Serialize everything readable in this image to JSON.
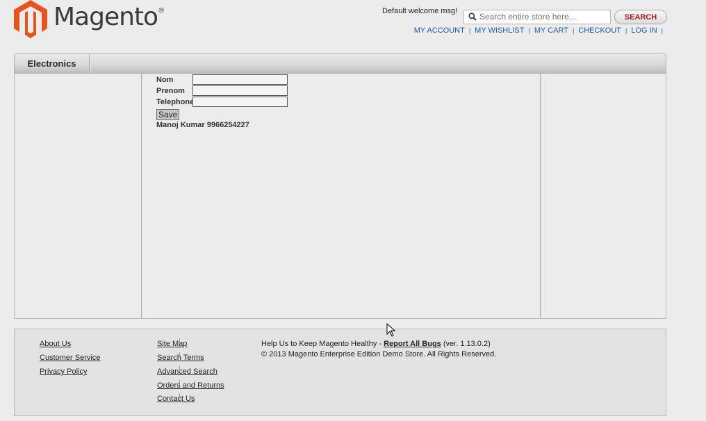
{
  "logo": {
    "text": "Magento",
    "reg": "®"
  },
  "header": {
    "welcome": "Default welcome msg!",
    "search_placeholder": "Search entire store here...",
    "search_button": "SEARCH",
    "links": [
      "MY ACCOUNT",
      "MY WISHLIST",
      "MY CART",
      "CHECKOUT",
      "LOG IN"
    ]
  },
  "nav": {
    "items": [
      "Electronics"
    ]
  },
  "form": {
    "labels": [
      "Nom",
      "Prenom",
      "Telephone"
    ],
    "values": [
      "",
      "",
      ""
    ],
    "save_label": "Save",
    "result": "Manoj Kumar 9966254227"
  },
  "footer": {
    "col1": [
      "About Us",
      "Customer Service",
      "Privacy Policy"
    ],
    "col2": [
      "Site Map",
      "Search Terms",
      "Advanced Search",
      "Orders and Returns",
      "Contact Us"
    ],
    "help_prefix": "Help Us to Keep Magento Healthy - ",
    "help_link": "Report All Bugs",
    "help_suffix": " (ver. 1.13.0.2)",
    "copyright": "© 2013 Magento Enterprise Edition Demo Store. All Rights Reserved."
  },
  "colors": {
    "link": "#1a5aa8",
    "search_button_text": "#a41818",
    "logo_orange": "#e8521c"
  }
}
